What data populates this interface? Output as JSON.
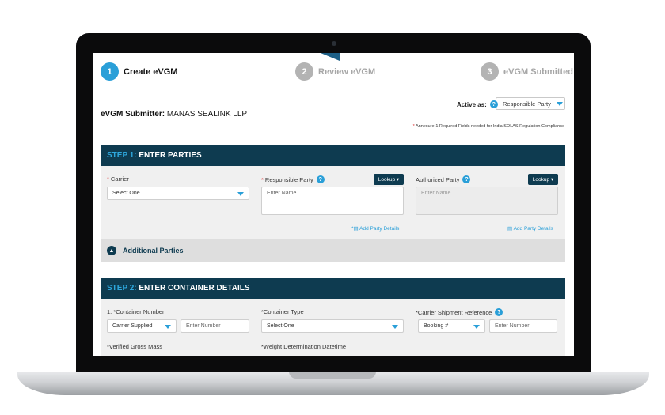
{
  "stepper": {
    "steps": [
      {
        "num": "1",
        "label": "Create eVGM"
      },
      {
        "num": "2",
        "label": "Review eVGM"
      },
      {
        "num": "3",
        "label": "eVGM Submitted"
      }
    ]
  },
  "submitter": {
    "label": "eVGM Submitter:",
    "value": "MANAS SEALINK LLP"
  },
  "active_as": {
    "label": "Active as:",
    "help": "?",
    "selected": "Responsible Party"
  },
  "annexure": {
    "star": "*",
    "text": "Annexure-1 Required Fields needed for India SOLAS Regulation Compliance"
  },
  "step1": {
    "step": "STEP 1:",
    "title": "ENTER PARTIES",
    "carrier": {
      "req": "*",
      "label": "Carrier",
      "selected": "Select One"
    },
    "responsible": {
      "req": "*",
      "label": "Responsible Party",
      "help": "?",
      "placeholder": "Enter Name",
      "lookup": "Lookup ▾",
      "add_link": "*▤ Add Party Details"
    },
    "authorized": {
      "label": "Authorized Party",
      "help": "?",
      "placeholder": "Enter Name",
      "lookup": "Lookup ▾",
      "add_link": "▤ Add Party Details"
    },
    "additional": {
      "label": "Additional Parties",
      "chevron": "▲"
    }
  },
  "step2": {
    "step": "STEP 2:",
    "title": "ENTER CONTAINER DETAILS",
    "container_number": {
      "label": "1. *Container Number",
      "selected": "Carrier Supplied",
      "placeholder": "Enter Number"
    },
    "container_type": {
      "label": "*Container Type",
      "selected": "Select One"
    },
    "shipment_ref": {
      "label": "*Carrier Shipment Reference",
      "help": "?",
      "selected": "Booking #",
      "placeholder": "Enter Number"
    },
    "vgm": {
      "label": "*Verified Gross Mass"
    },
    "weight_dt": {
      "label": "*Weight Determination Datetime"
    }
  },
  "colors": {
    "accent": "#2a9fd8",
    "header": "#0e3b50"
  }
}
